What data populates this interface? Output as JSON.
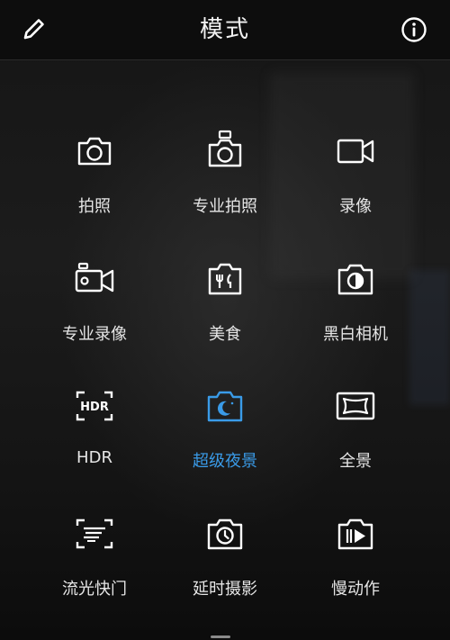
{
  "header": {
    "title": "模式"
  },
  "colors": {
    "active": "#3a9be8",
    "icon": "#ffffff",
    "label": "#e6e6e6"
  },
  "modes": [
    {
      "label": "拍照",
      "icon": "camera-icon"
    },
    {
      "label": "专业拍照",
      "icon": "pro-camera-icon"
    },
    {
      "label": "录像",
      "icon": "video-camera-icon"
    },
    {
      "label": "专业录像",
      "icon": "pro-video-icon"
    },
    {
      "label": "美食",
      "icon": "food-camera-icon"
    },
    {
      "label": "黑白相机",
      "icon": "monochrome-camera-icon"
    },
    {
      "label": "HDR",
      "icon": "hdr-icon"
    },
    {
      "label": "超级夜景",
      "icon": "night-camera-icon",
      "selected": true
    },
    {
      "label": "全景",
      "icon": "panorama-icon"
    },
    {
      "label": "流光快门",
      "icon": "light-painting-icon"
    },
    {
      "label": "延时摄影",
      "icon": "time-lapse-icon"
    },
    {
      "label": "慢动作",
      "icon": "slow-motion-icon"
    }
  ]
}
